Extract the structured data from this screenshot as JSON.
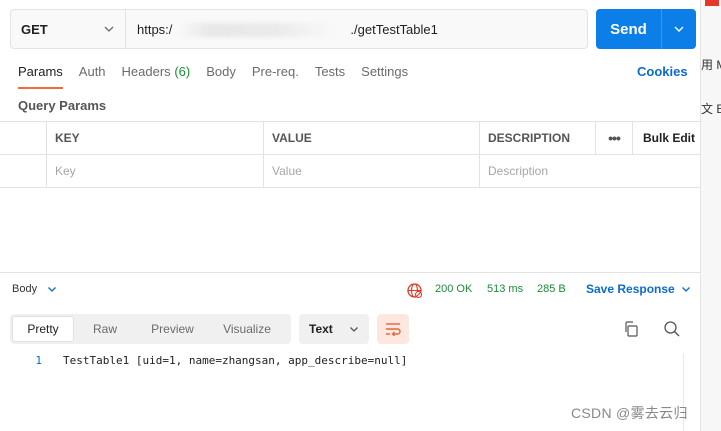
{
  "request": {
    "method": "GET",
    "url_prefix": "https:/",
    "url_suffix": "./getTestTable1",
    "send_label": "Send"
  },
  "tabs": [
    {
      "label": "Params",
      "active": true
    },
    {
      "label": "Auth"
    },
    {
      "label": "Headers",
      "count": "(6)"
    },
    {
      "label": "Body"
    },
    {
      "label": "Pre-req."
    },
    {
      "label": "Tests"
    },
    {
      "label": "Settings"
    }
  ],
  "cookies_label": "Cookies",
  "query_params": {
    "title": "Query Params",
    "headers": {
      "key": "KEY",
      "value": "VALUE",
      "description": "DESCRIPTION",
      "more": "•••",
      "bulk_edit": "Bulk Edit"
    },
    "placeholders": {
      "key": "Key",
      "value": "Value",
      "description": "Description"
    }
  },
  "response": {
    "body_label": "Body",
    "status": "200 OK",
    "time": "513 ms",
    "size": "285 B",
    "save_label": "Save Response",
    "view_tabs": [
      "Pretty",
      "Raw",
      "Preview",
      "Visualize"
    ],
    "active_view": "Pretty",
    "format": "Text",
    "lines": [
      {
        "num": "1",
        "text": "TestTable1 [uid=1, name=zhangsan, app_describe=null]"
      }
    ]
  },
  "side_strip": {
    "line1": "用 M",
    "line2": "文 E"
  },
  "watermark": "CSDN @雾去云归",
  "colors": {
    "accent": "#f26b3a",
    "send": "#0b7ee8",
    "link": "#0b6cc8",
    "success": "#1e8b3a"
  }
}
